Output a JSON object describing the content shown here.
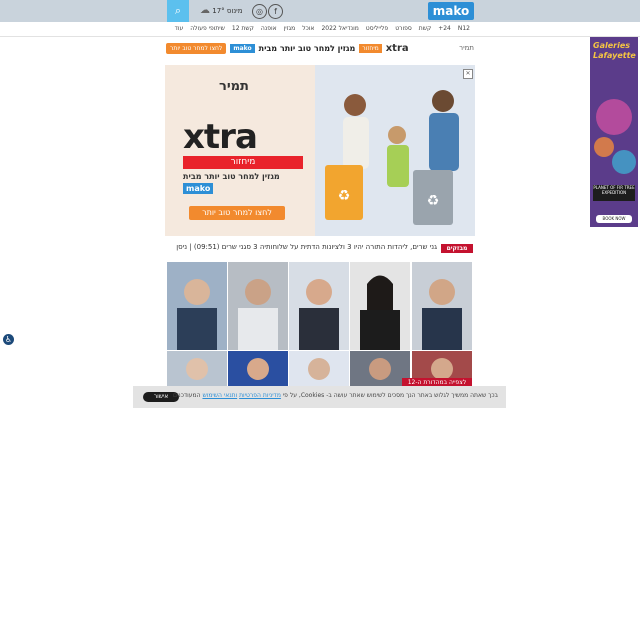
{
  "header": {
    "logo_text": "mako",
    "weather_text": "מינוס 17°",
    "nav_items": [
      "N12",
      "+24",
      "קשת",
      "ספורט",
      "פלייליסט",
      "מונדיאל 2022",
      "אוכל",
      "מגזין",
      "אופנה",
      "קשת 12",
      "שיתופי פעולה",
      "עוד"
    ]
  },
  "promo_strip": {
    "cta": "לחצו למחר טוב יותר",
    "maco": "mako",
    "tagline": "מגזין למחר טוב יותר מבית",
    "xtra": "xtra",
    "orange_tag": "מיחזור",
    "tamir": "תמיר"
  },
  "banner": {
    "tamir": "תמיר",
    "xtra": "xtra",
    "bar": "מיחזור",
    "sub": "מגזין למחר טוב יותר מבית",
    "maco": "mako",
    "cta": "לחצו למחר טוב יותר"
  },
  "ticker": {
    "label": "מבזקים",
    "text": "גני שרים, ליהדות התורה יהיו 3 ולציונות הדתית על שלוחותיה 3 סגני שרים (09:51) | ניסן"
  },
  "photo_badge": "לצפייה במהדורת ה-12",
  "side_ad": {
    "title": "Galeries Lafayette",
    "box": "PLANET OF FIR TREE EXPEDITION",
    "button": "BOOK NOW"
  },
  "cookie": {
    "button": "אישור",
    "text": "בכך שאתה ממשיך לגלוש באתר הנך מסכים לשימוש שאתר עושה ב- Cookies, על פי",
    "privacy_link": "מדיניות הפרטיות",
    "terms_link": "ותנאי השימוש",
    "suffix": "המעודכנים"
  },
  "colors": {
    "brand_blue": "#2d8fd6",
    "news_red": "#c4122f",
    "orange": "#f28a2e"
  }
}
